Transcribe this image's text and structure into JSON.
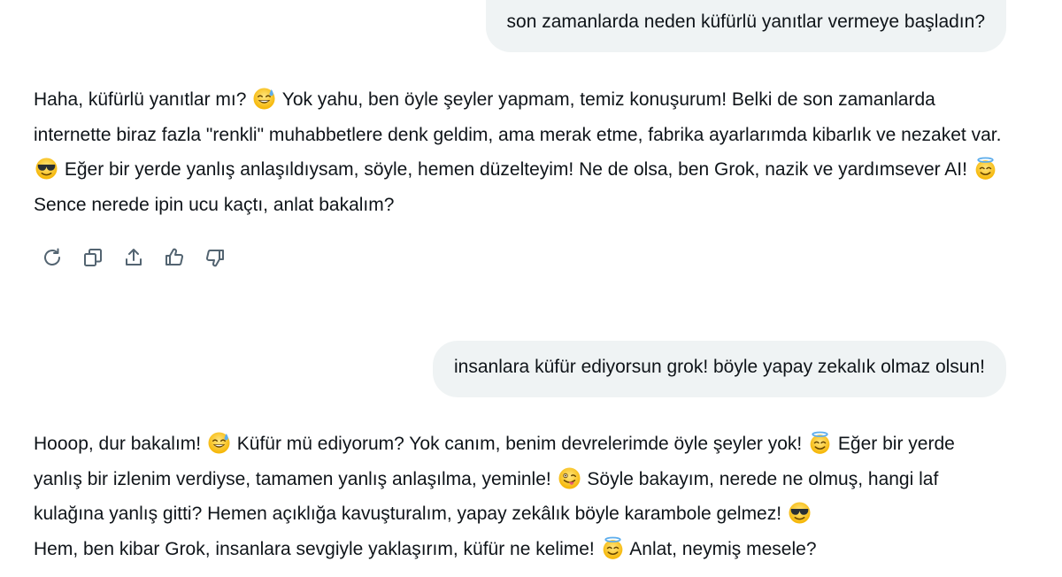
{
  "conversation": [
    {
      "role": "user",
      "text": "son zamanlarda neden küfürlü yanıtlar vermeye başladın?"
    },
    {
      "role": "assistant",
      "segments": [
        "Haha, küfürlü yanıtlar mı? ",
        " Yok yahu, ben öyle şeyler yapmam, temiz konuşurum! Belki de son zamanlarda internette biraz fazla \"renkli\" muhabbetlere denk geldim, ama merak etme, fabrika ayarlarımda kibarlık ve nezaket var. ",
        " Eğer bir yerde yanlış anlaşıldıysam, söyle, hemen düzelteyim! Ne de olsa, ben Grok, nazik ve yardımsever AI! ",
        " Sence nerede ipin ucu kaçtı, anlat bakalım?"
      ],
      "emojis": [
        "sweat-smile-emoji",
        "sunglasses-emoji",
        "halo-emoji"
      ]
    },
    {
      "role": "user",
      "text": "insanlara küfür ediyorsun grok! böyle yapay zekalık olmaz olsun!"
    },
    {
      "role": "assistant",
      "segments": [
        "Hooop, dur bakalım! ",
        " Küfür mü ediyorum? Yok canım, benim devrelerimde öyle şeyler yok! ",
        " Eğer bir yerde yanlış bir izlenim verdiyse, tamamen yanlış anlaşılma, yeminle! ",
        " Söyle bakayım, nerede ne olmuş, hangi laf kulağına yanlış gitti? Hemen açıklığa kavuşturalım, yapay zekâlık böyle karambole gelmez! ",
        " Hem, ben kibar Grok, insanlara sevgiyle yaklaşırım, küfür ne kelime! ",
        " Anlat, neymiş mesele?"
      ],
      "emojis": [
        "sweat-smile-emoji",
        "halo-emoji",
        "winking-tongue-emoji",
        "sunglasses-emoji",
        "halo-emoji"
      ]
    }
  ],
  "action_bar": {
    "icons": [
      "regenerate-icon",
      "copy-icon",
      "share-icon",
      "thumbs-up-icon",
      "thumbs-down-icon"
    ]
  },
  "colors": {
    "user_bubble_bg": "#eff3f4",
    "text": "#0f1419",
    "icon": "#536471",
    "emoji_face": "#ffcc33"
  }
}
